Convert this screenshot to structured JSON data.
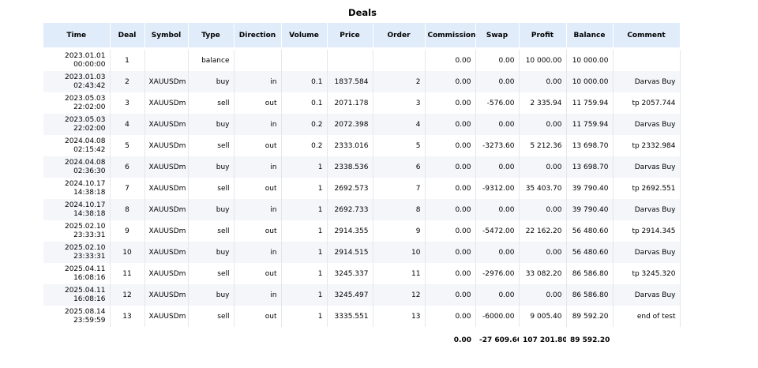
{
  "title": "Deals",
  "columns": [
    "Time",
    "Deal",
    "Symbol",
    "Type",
    "Direction",
    "Volume",
    "Price",
    "Order",
    "Commission",
    "Swap",
    "Profit",
    "Balance",
    "Comment"
  ],
  "rows": [
    {
      "date": "2023.01.01",
      "time": "00:00:00",
      "deal": "1",
      "symbol": "",
      "type": "balance",
      "direction": "",
      "volume": "",
      "price": "",
      "order": "",
      "commission": "0.00",
      "swap": "0.00",
      "profit": "10 000.00",
      "balance": "10 000.00",
      "comment": ""
    },
    {
      "date": "2023.01.03",
      "time": "02:43:42",
      "deal": "2",
      "symbol": "XAUUSDm",
      "type": "buy",
      "direction": "in",
      "volume": "0.1",
      "price": "1837.584",
      "order": "2",
      "commission": "0.00",
      "swap": "0.00",
      "profit": "0.00",
      "balance": "10 000.00",
      "comment": "Darvas Buy"
    },
    {
      "date": "2023.05.03",
      "time": "22:02:00",
      "deal": "3",
      "symbol": "XAUUSDm",
      "type": "sell",
      "direction": "out",
      "volume": "0.1",
      "price": "2071.178",
      "order": "3",
      "commission": "0.00",
      "swap": "-576.00",
      "profit": "2 335.94",
      "balance": "11 759.94",
      "comment": "tp 2057.744"
    },
    {
      "date": "2023.05.03",
      "time": "22:02:00",
      "deal": "4",
      "symbol": "XAUUSDm",
      "type": "buy",
      "direction": "in",
      "volume": "0.2",
      "price": "2072.398",
      "order": "4",
      "commission": "0.00",
      "swap": "0.00",
      "profit": "0.00",
      "balance": "11 759.94",
      "comment": "Darvas Buy"
    },
    {
      "date": "2024.04.08",
      "time": "02:15:42",
      "deal": "5",
      "symbol": "XAUUSDm",
      "type": "sell",
      "direction": "out",
      "volume": "0.2",
      "price": "2333.016",
      "order": "5",
      "commission": "0.00",
      "swap": "-3273.60",
      "profit": "5 212.36",
      "balance": "13 698.70",
      "comment": "tp 2332.984"
    },
    {
      "date": "2024.04.08",
      "time": "02:36:30",
      "deal": "6",
      "symbol": "XAUUSDm",
      "type": "buy",
      "direction": "in",
      "volume": "1",
      "price": "2338.536",
      "order": "6",
      "commission": "0.00",
      "swap": "0.00",
      "profit": "0.00",
      "balance": "13 698.70",
      "comment": "Darvas Buy"
    },
    {
      "date": "2024.10.17",
      "time": "14:38:18",
      "deal": "7",
      "symbol": "XAUUSDm",
      "type": "sell",
      "direction": "out",
      "volume": "1",
      "price": "2692.573",
      "order": "7",
      "commission": "0.00",
      "swap": "-9312.00",
      "profit": "35 403.70",
      "balance": "39 790.40",
      "comment": "tp 2692.551"
    },
    {
      "date": "2024.10.17",
      "time": "14:38:18",
      "deal": "8",
      "symbol": "XAUUSDm",
      "type": "buy",
      "direction": "in",
      "volume": "1",
      "price": "2692.733",
      "order": "8",
      "commission": "0.00",
      "swap": "0.00",
      "profit": "0.00",
      "balance": "39 790.40",
      "comment": "Darvas Buy"
    },
    {
      "date": "2025.02.10",
      "time": "23:33:31",
      "deal": "9",
      "symbol": "XAUUSDm",
      "type": "sell",
      "direction": "out",
      "volume": "1",
      "price": "2914.355",
      "order": "9",
      "commission": "0.00",
      "swap": "-5472.00",
      "profit": "22 162.20",
      "balance": "56 480.60",
      "comment": "tp 2914.345"
    },
    {
      "date": "2025.02.10",
      "time": "23:33:31",
      "deal": "10",
      "symbol": "XAUUSDm",
      "type": "buy",
      "direction": "in",
      "volume": "1",
      "price": "2914.515",
      "order": "10",
      "commission": "0.00",
      "swap": "0.00",
      "profit": "0.00",
      "balance": "56 480.60",
      "comment": "Darvas Buy"
    },
    {
      "date": "2025.04.11",
      "time": "16:08:16",
      "deal": "11",
      "symbol": "XAUUSDm",
      "type": "sell",
      "direction": "out",
      "volume": "1",
      "price": "3245.337",
      "order": "11",
      "commission": "0.00",
      "swap": "-2976.00",
      "profit": "33 082.20",
      "balance": "86 586.80",
      "comment": "tp 3245.320"
    },
    {
      "date": "2025.04.11",
      "time": "16:08:16",
      "deal": "12",
      "symbol": "XAUUSDm",
      "type": "buy",
      "direction": "in",
      "volume": "1",
      "price": "3245.497",
      "order": "12",
      "commission": "0.00",
      "swap": "0.00",
      "profit": "0.00",
      "balance": "86 586.80",
      "comment": "Darvas Buy"
    },
    {
      "date": "2025.08.14",
      "time": "23:59:59",
      "deal": "13",
      "symbol": "XAUUSDm",
      "type": "sell",
      "direction": "out",
      "volume": "1",
      "price": "3335.551",
      "order": "13",
      "commission": "0.00",
      "swap": "-6000.00",
      "profit": "9 005.40",
      "balance": "89 592.20",
      "comment": "end of test"
    }
  ],
  "totals": {
    "commission": "0.00",
    "swap": "-27 609.60",
    "profit": "107 201.80",
    "balance": "89 592.20"
  }
}
